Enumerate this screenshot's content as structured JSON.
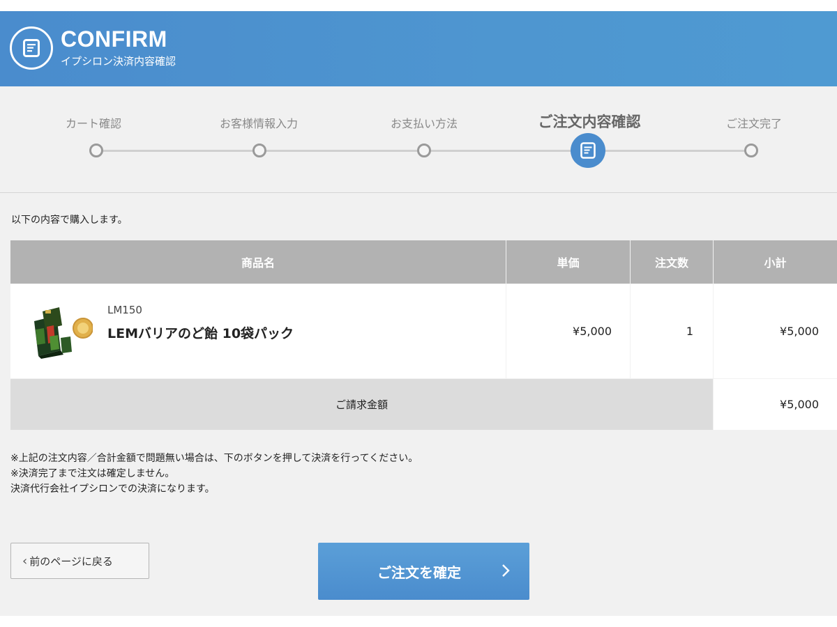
{
  "header": {
    "title": "CONFIRM",
    "subtitle": "イプシロン決済内容確認",
    "icon": "document-icon"
  },
  "steps": [
    {
      "label": "カート確認",
      "active": false
    },
    {
      "label": "お客様情報入力",
      "active": false
    },
    {
      "label": "お支払い方法",
      "active": false
    },
    {
      "label": "ご注文内容確認",
      "active": true
    },
    {
      "label": "ご注文完了",
      "active": false
    }
  ],
  "intro": "以下の内容で購入します。",
  "table": {
    "headers": {
      "product": "商品名",
      "unit_price": "単価",
      "quantity": "注文数",
      "subtotal": "小計"
    },
    "rows": [
      {
        "code": "LM150",
        "name": "LEMバリアのど飴 10袋パック",
        "unit_price": "¥5,000",
        "quantity": "1",
        "subtotal": "¥5,000"
      }
    ],
    "total_label": "ご請求金額",
    "total_value": "¥5,000"
  },
  "notes": [
    "※上記の注文内容／合計金額で問題無い場合は、下のボタンを押して決済を行ってください。",
    "※決済完了まで注文は確定しません。",
    "決済代行会社イプシロンでの決済になります。"
  ],
  "buttons": {
    "back": "前のページに戻る",
    "confirm": "ご注文を確定"
  },
  "colors": {
    "accent": "#4a8ccd",
    "table_header": "#b2b2b2",
    "total_row": "#dcdcdc",
    "background": "#f1f1f1"
  }
}
